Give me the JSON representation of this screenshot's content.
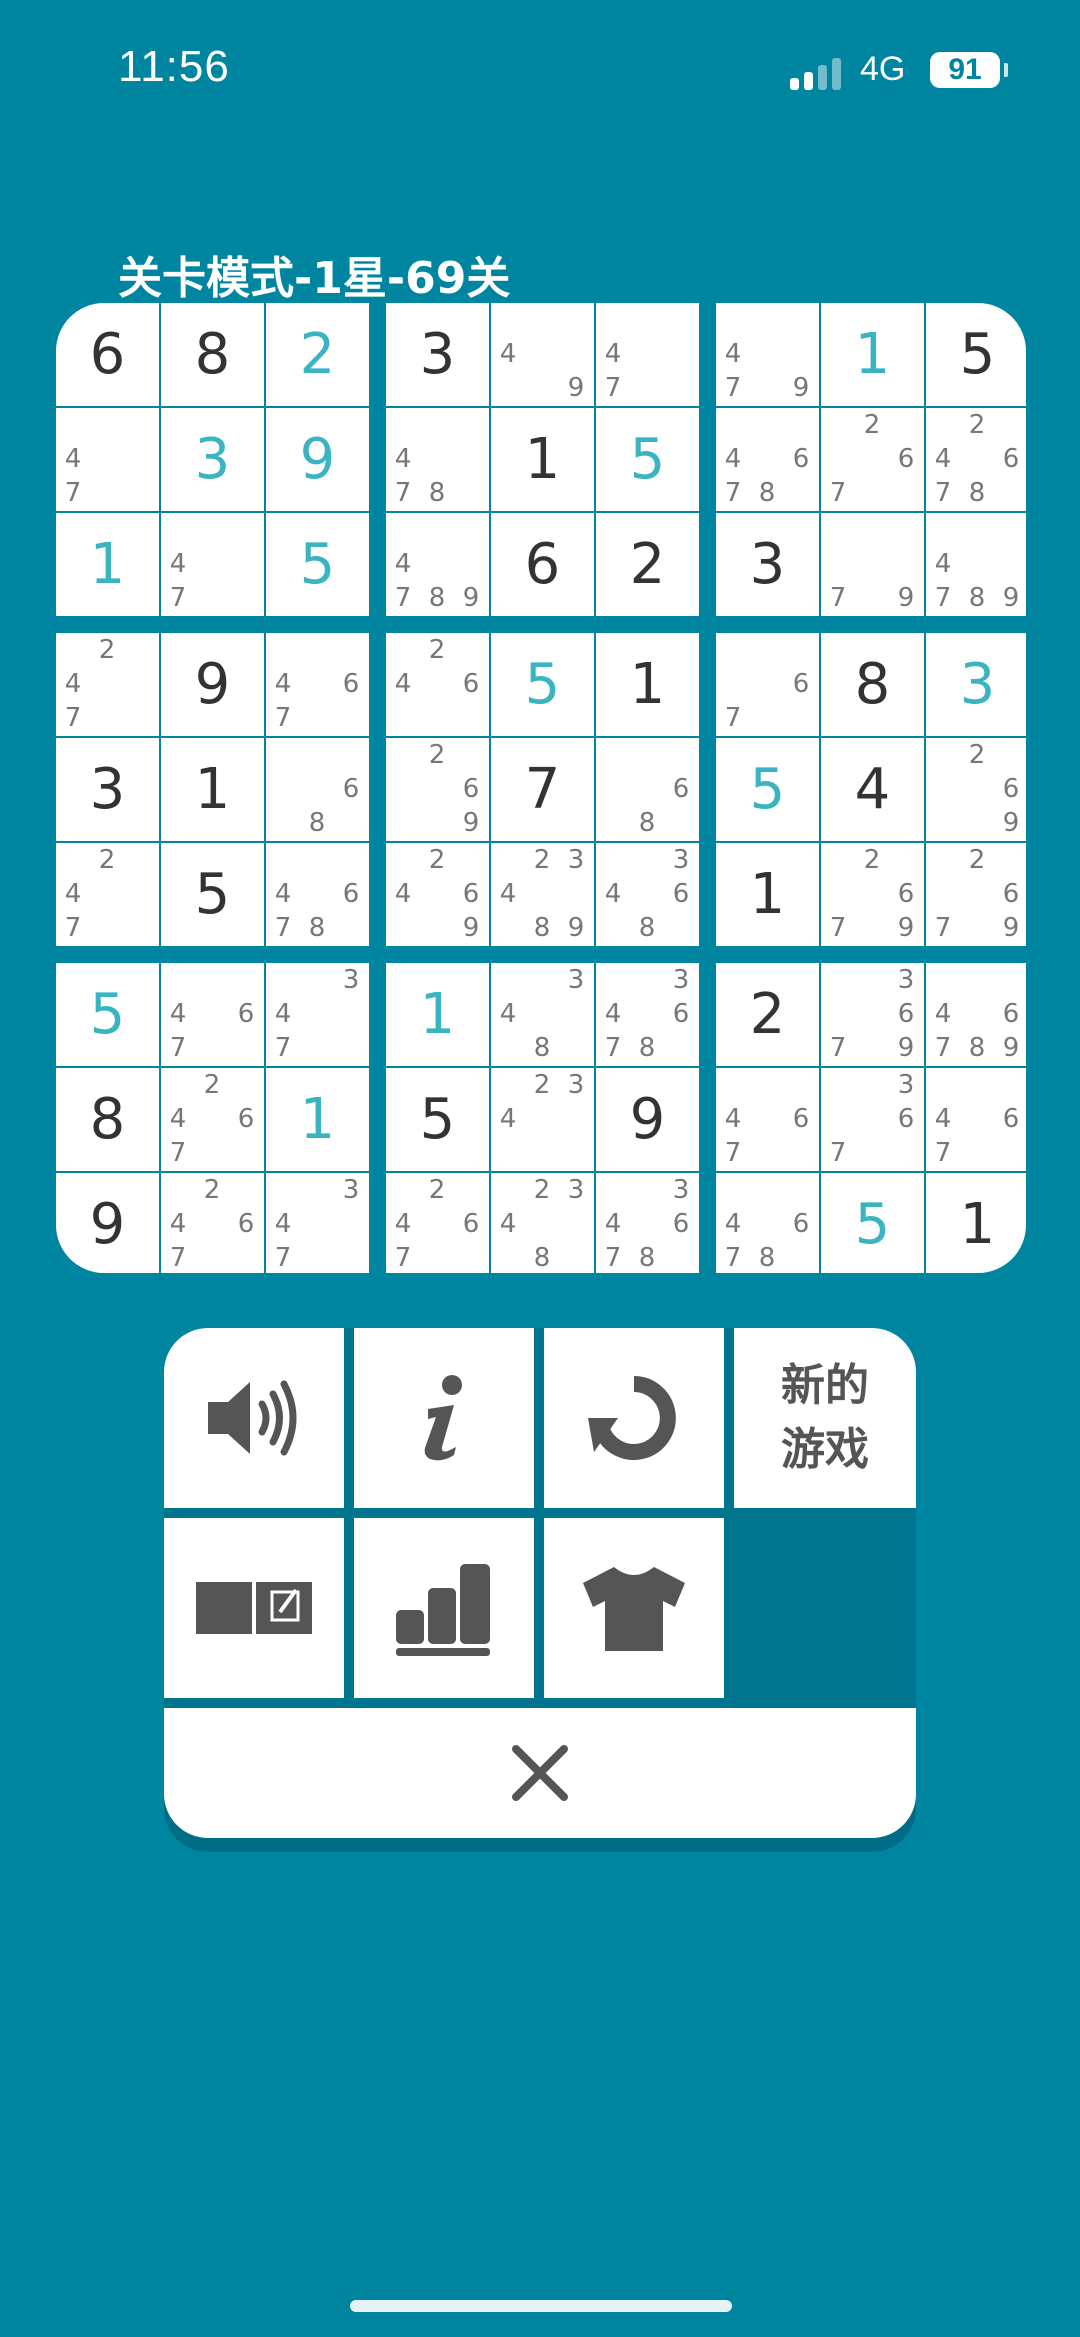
{
  "status_bar": {
    "time": "11:56",
    "network": "4G",
    "battery": "91"
  },
  "level_title": "关卡模式-1星-69关",
  "colors": {
    "background": "#0085a1",
    "given_digit": "#333333",
    "user_digit": "#3ab4c0",
    "note": "#777777"
  },
  "board": [
    [
      {
        "v": "6",
        "t": "given"
      },
      {
        "v": "8",
        "t": "given"
      },
      {
        "v": "2",
        "t": "user"
      },
      {
        "v": "3",
        "t": "given"
      },
      {
        "n": "49"
      },
      {
        "n": "47"
      },
      {
        "n": "479"
      },
      {
        "v": "1",
        "t": "user"
      },
      {
        "v": "5",
        "t": "given"
      }
    ],
    [
      {
        "n": "47"
      },
      {
        "v": "3",
        "t": "user"
      },
      {
        "v": "9",
        "t": "user"
      },
      {
        "n": "478"
      },
      {
        "v": "1",
        "t": "given"
      },
      {
        "v": "5",
        "t": "user"
      },
      {
        "n": "4678"
      },
      {
        "n": "267"
      },
      {
        "n": "24678"
      }
    ],
    [
      {
        "v": "1",
        "t": "user"
      },
      {
        "n": "47"
      },
      {
        "v": "5",
        "t": "user"
      },
      {
        "n": "4789"
      },
      {
        "v": "6",
        "t": "given"
      },
      {
        "v": "2",
        "t": "given"
      },
      {
        "v": "3",
        "t": "given"
      },
      {
        "n": "79"
      },
      {
        "n": "4789"
      }
    ],
    [
      {
        "n": "247"
      },
      {
        "v": "9",
        "t": "given"
      },
      {
        "n": "467"
      },
      {
        "n": "246"
      },
      {
        "v": "5",
        "t": "user"
      },
      {
        "v": "1",
        "t": "given"
      },
      {
        "n": "67"
      },
      {
        "v": "8",
        "t": "given"
      },
      {
        "v": "3",
        "t": "user"
      }
    ],
    [
      {
        "v": "3",
        "t": "given"
      },
      {
        "v": "1",
        "t": "given"
      },
      {
        "n": "68"
      },
      {
        "n": "269"
      },
      {
        "v": "7",
        "t": "given"
      },
      {
        "n": "68"
      },
      {
        "v": "5",
        "t": "user"
      },
      {
        "v": "4",
        "t": "given"
      },
      {
        "n": "269"
      }
    ],
    [
      {
        "n": "247"
      },
      {
        "v": "5",
        "t": "given"
      },
      {
        "n": "4678"
      },
      {
        "n": "2469"
      },
      {
        "n": "23489"
      },
      {
        "n": "3468"
      },
      {
        "v": "1",
        "t": "given"
      },
      {
        "n": "2679"
      },
      {
        "n": "2679"
      }
    ],
    [
      {
        "v": "5",
        "t": "user"
      },
      {
        "n": "467"
      },
      {
        "n": "347"
      },
      {
        "v": "1",
        "t": "user"
      },
      {
        "n": "348"
      },
      {
        "n": "34678"
      },
      {
        "v": "2",
        "t": "given"
      },
      {
        "n": "3679"
      },
      {
        "n": "46789"
      }
    ],
    [
      {
        "v": "8",
        "t": "given"
      },
      {
        "n": "2467"
      },
      {
        "v": "1",
        "t": "user"
      },
      {
        "v": "5",
        "t": "given"
      },
      {
        "n": "234"
      },
      {
        "v": "9",
        "t": "given"
      },
      {
        "n": "467"
      },
      {
        "n": "367"
      },
      {
        "n": "467"
      }
    ],
    [
      {
        "v": "9",
        "t": "given"
      },
      {
        "n": "2467"
      },
      {
        "n": "347"
      },
      {
        "n": "2467"
      },
      {
        "n": "2348"
      },
      {
        "n": "34678"
      },
      {
        "n": "4678"
      },
      {
        "v": "5",
        "t": "user"
      },
      {
        "v": "1",
        "t": "given"
      }
    ]
  ],
  "menu": {
    "sound_icon": "speaker-icon",
    "info_icon": "info-icon",
    "restart_icon": "restart-icon",
    "new_game_line1": "新的",
    "new_game_line2": "游戏",
    "notes_icon": "notes-pencil-icon",
    "stats_icon": "bar-chart-icon",
    "theme_icon": "tshirt-icon",
    "close_icon": "close-icon"
  }
}
